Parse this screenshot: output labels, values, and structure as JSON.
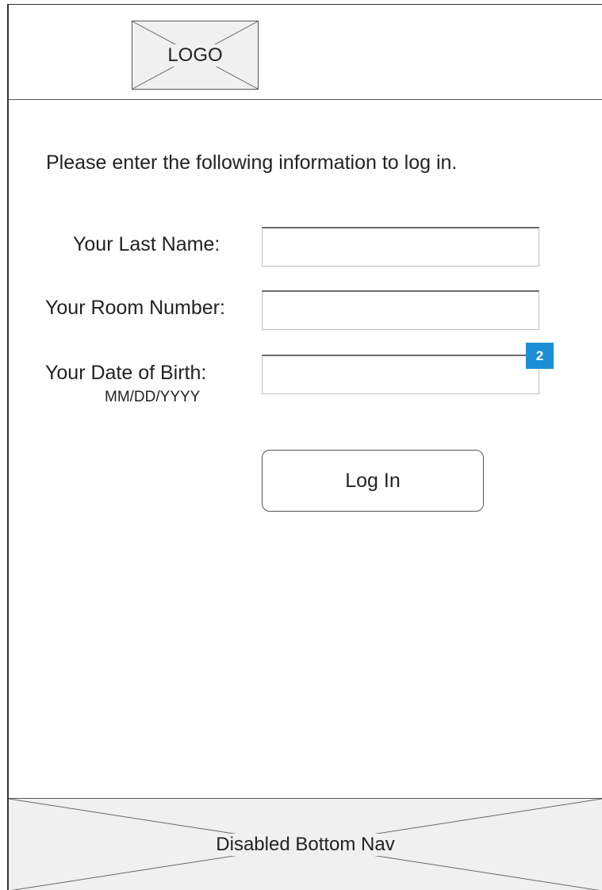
{
  "header": {
    "logo_text": "LOGO"
  },
  "main": {
    "intro": "Please enter the following information to log in.",
    "fields": {
      "last_name": {
        "label": "Your Last Name:",
        "value": ""
      },
      "room_number": {
        "label": "Your Room Number:",
        "value": ""
      },
      "date_of_birth": {
        "label": "Your Date of Birth:",
        "format_hint": "MM/DD/YYYY",
        "value": "",
        "badge": "2"
      }
    },
    "login_button": "Log In"
  },
  "bottom_nav": {
    "label": "Disabled Bottom Nav"
  },
  "colors": {
    "badge": "#1b8fd6",
    "placeholder_fill": "#f0f0f0"
  }
}
